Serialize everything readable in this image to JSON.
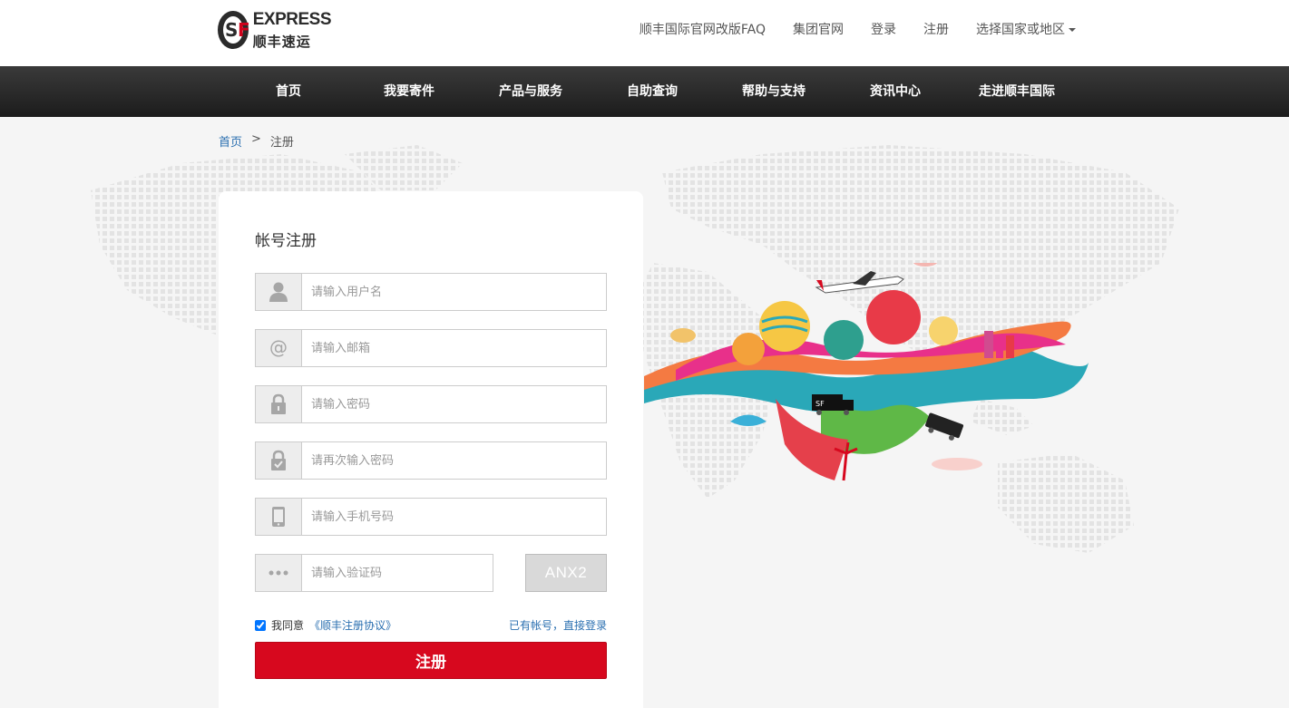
{
  "header": {
    "logo_text_en": "EXPRESS",
    "logo_text_cn": "顺丰速运",
    "links": [
      {
        "label": "顺丰国际官网改版FAQ"
      },
      {
        "label": "集团官网"
      },
      {
        "label": "登录"
      },
      {
        "label": "注册"
      },
      {
        "label": "选择国家或地区"
      }
    ]
  },
  "nav": {
    "items": [
      {
        "label": "首页"
      },
      {
        "label": "我要寄件"
      },
      {
        "label": "产品与服务"
      },
      {
        "label": "自助查询"
      },
      {
        "label": "帮助与支持"
      },
      {
        "label": "资讯中心"
      },
      {
        "label": "走进顺丰国际"
      }
    ]
  },
  "breadcrumb": {
    "home": "首页",
    "separator": ">",
    "current": "注册"
  },
  "form": {
    "title": "帐号注册",
    "fields": [
      {
        "placeholder": "请输入用户名",
        "icon": "user-icon"
      },
      {
        "placeholder": "请输入邮箱",
        "icon": "at-icon"
      },
      {
        "placeholder": "请输入密码",
        "icon": "lock-icon"
      },
      {
        "placeholder": "请再次输入密码",
        "icon": "lock-check-icon"
      },
      {
        "placeholder": "请输入手机号码",
        "icon": "phone-icon"
      },
      {
        "placeholder": "请输入验证码",
        "icon": "dots-icon"
      }
    ],
    "captcha_text": "ANX2",
    "agree_text": "我同意",
    "agreement_link": "《顺丰注册协议》",
    "login_link": "已有帐号，直接登录",
    "submit_label": "注册"
  },
  "colors": {
    "brand_red": "#d7081e",
    "link_blue": "#2a6fb0",
    "nav_bg": "#2a2a2a"
  }
}
